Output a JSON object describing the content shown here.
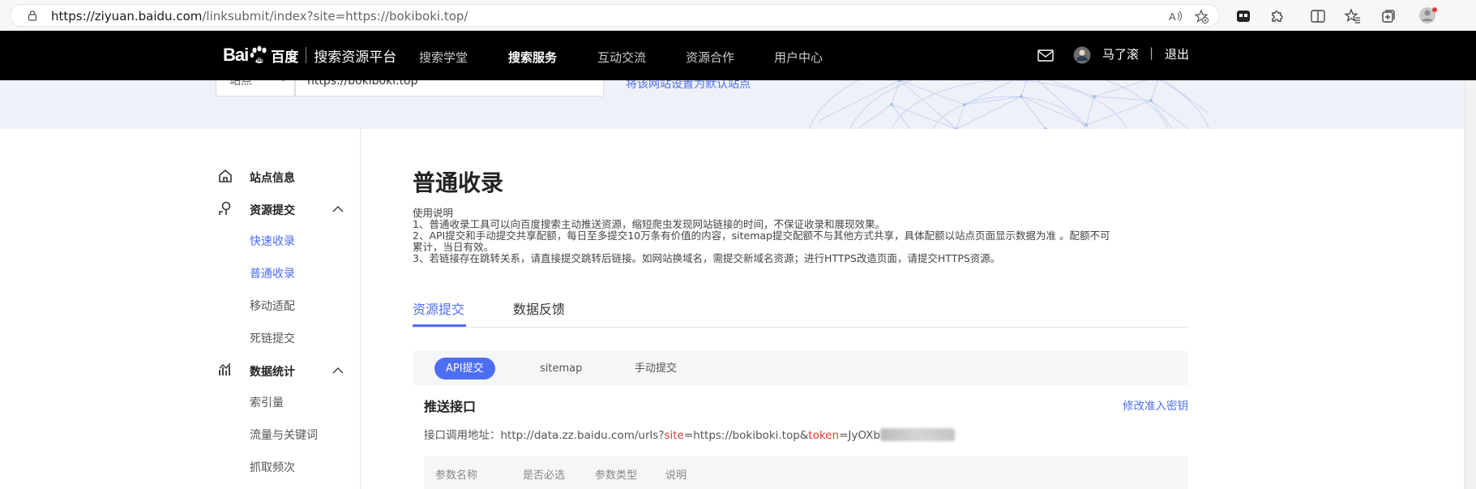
{
  "browser": {
    "url_host": "https://ziyuan.baidu.com",
    "url_path": "/linksubmit/index?site=https://bokiboki.top/"
  },
  "header": {
    "logo_text": "Bai",
    "logo_cn": "百度",
    "platform": "搜索资源平台",
    "nav": [
      "搜索学堂",
      "搜索服务",
      "互动交流",
      "资源合作",
      "用户中心"
    ],
    "active_nav": "搜索服务",
    "username": "马了滚",
    "separator": "|",
    "logout": "退出"
  },
  "sitebar": {
    "select_label": "站点",
    "site_value": "https://bokiboki.top",
    "default_link": "将该网站设置为默认站点"
  },
  "sidebar": {
    "site_info": "站点信息",
    "resource_submit": "资源提交",
    "quick_index": "快速收录",
    "normal_index": "普通收录",
    "mobile_adapt": "移动适配",
    "dead_link": "死链提交",
    "data_stats": "数据统计",
    "index_volume": "索引量",
    "traffic_keywords": "流量与关键词",
    "crawl_frequency": "抓取频次"
  },
  "main": {
    "title": "普通收录",
    "desc_heading": "使用说明",
    "desc_1": "1、普通收录工具可以向百度搜索主动推送资源，缩短爬虫发现网站链接的时间，不保证收录和展现效果。",
    "desc_2a": "2、API提交和手动提交共享配额，每日至多提交10万条有价值的内容，sitemap提交配额不与其他方式共享，具体配额以站点页面显示数据为准 。配额不可",
    "desc_2b": "累计，当日有效。",
    "desc_3": "3、若链接存在跳转关系，请直接提交跳转后链接。如网站换域名，需提交新域名资源；进行HTTPS改造页面，请提交HTTPS资源。",
    "tabs": [
      "资源提交",
      "数据反馈"
    ],
    "subtabs": [
      "API提交",
      "sitemap",
      "手动提交"
    ],
    "push_title": "推送接口",
    "modify_key": "修改准入密钥",
    "url_label": "接口调用地址：http://data.zz.baidu.com/urls?",
    "url_site_key": "site",
    "url_mid": "=https://bokiboki.top&",
    "url_token_key": "token",
    "url_token_val": "=JyOXb",
    "table_headers": [
      "参数名称",
      "是否必选",
      "参数类型",
      "说明"
    ]
  },
  "colors": {
    "accent": "#4e6ef2",
    "header_bg": "#000000",
    "param_red": "#e53935"
  }
}
